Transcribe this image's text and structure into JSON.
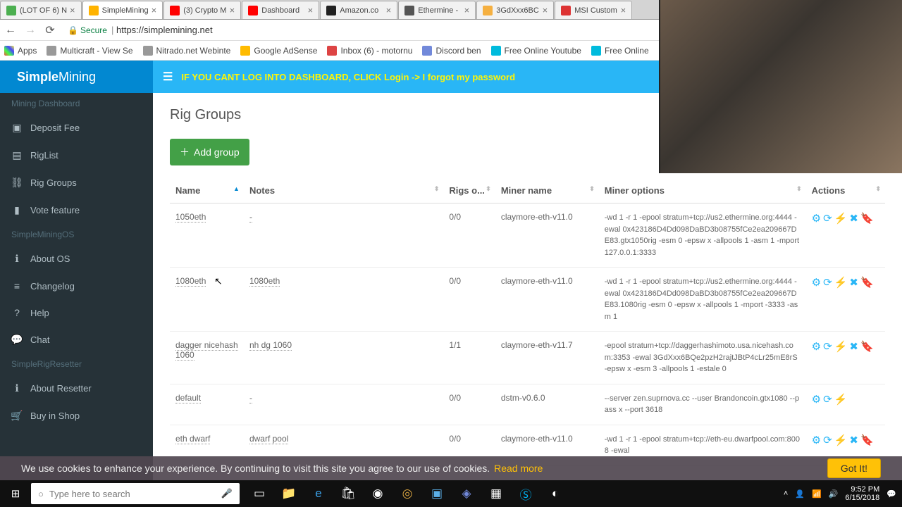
{
  "browser": {
    "tabs": [
      {
        "label": "(LOT OF 6) N",
        "favicon": "#4caf50"
      },
      {
        "label": "SimpleMining",
        "favicon": "#ffb300",
        "active": true
      },
      {
        "label": "(3) Crypto M",
        "favicon": "#f00"
      },
      {
        "label": "Dashboard",
        "favicon": "#f00"
      },
      {
        "label": "Amazon.co",
        "favicon": "#222"
      },
      {
        "label": "Ethermine -",
        "favicon": "#555"
      },
      {
        "label": "3GdXxx6BC",
        "favicon": "#f5b041"
      },
      {
        "label": "MSI Custom",
        "favicon": "#d33"
      }
    ],
    "secure_label": "Secure",
    "url": "https://simplemining.net",
    "bookmarks": [
      {
        "label": "Apps",
        "color": "#55f"
      },
      {
        "label": "Multicraft - View Se",
        "color": "#999"
      },
      {
        "label": "Nitrado.net Webinte",
        "color": "#999"
      },
      {
        "label": "Google AdSense",
        "color": "#fb0"
      },
      {
        "label": "Inbox (6) - motornu",
        "color": "#d44"
      },
      {
        "label": "Discord ben",
        "color": "#7289da"
      },
      {
        "label": "Free Online Youtube",
        "color": "#0bd"
      },
      {
        "label": "Free Online",
        "color": "#0bd"
      }
    ]
  },
  "banner": "IF YOU CANT LOG INTO DASHBOARD, CLICK Login -> I forgot my password",
  "logo": {
    "a": "Simple",
    "b": "Mining"
  },
  "sidebar": {
    "sec1": "Mining Dashboard",
    "items1": [
      {
        "icon": "▣",
        "label": "Deposit Fee"
      },
      {
        "icon": "▤",
        "label": "RigList"
      },
      {
        "icon": "⛓",
        "label": "Rig Groups"
      },
      {
        "icon": "▮",
        "label": "Vote feature"
      }
    ],
    "sec2": "SimpleMiningOS",
    "items2": [
      {
        "icon": "ℹ",
        "label": "About OS"
      },
      {
        "icon": "≡",
        "label": "Changelog"
      },
      {
        "icon": "?",
        "label": "Help"
      },
      {
        "icon": "💬",
        "label": "Chat"
      }
    ],
    "sec3": "SimpleRigResetter",
    "items3": [
      {
        "icon": "ℹ",
        "label": "About Resetter"
      },
      {
        "icon": "🛒",
        "label": "Buy in Shop"
      }
    ]
  },
  "page": {
    "title": "Rig Groups",
    "add_btn": "Add group"
  },
  "table": {
    "headers": {
      "name": "Name",
      "notes": "Notes",
      "rigs": "Rigs o...",
      "miner": "Miner name",
      "opts": "Miner options",
      "actions": "Actions"
    },
    "rows": [
      {
        "name": "1050eth",
        "notes": "-",
        "rigs": "0/0",
        "miner": "claymore-eth-v11.0",
        "opts": "-wd 1 -r 1 -epool stratum+tcp://us2.ethermine.org:4444 -ewal 0x423186D4Dd098DaBD3b08755fCe2ea209667DE83.gtx1050rig -esm 0 -epsw x -allpools 1 -asm 1 -mport 127.0.0.1:3333",
        "acts": "⚙ ⟳ ⚡ ✖ 🔖"
      },
      {
        "name": "1080eth",
        "notes": "1080eth",
        "rigs": "0/0",
        "miner": "claymore-eth-v11.0",
        "opts": "-wd 1 -r 1 -epool stratum+tcp://us2.ethermine.org:4444 -ewal 0x423186D4Dd098DaBD3b08755fCe2ea209667DE83.1080rig -esm 0 -epsw x -allpools 1 -mport -3333 -asm 1",
        "acts": "⚙ ⟳ ⚡ ✖ 🔖"
      },
      {
        "name": "dagger nicehash 1060",
        "notes": "nh dg 1060",
        "rigs": "1/1",
        "miner": "claymore-eth-v11.7",
        "opts": "-epool stratum+tcp://daggerhashimoto.usa.nicehash.com:3353 -ewal 3GdXxx6BQe2pzH2rajtJBtP4cLr25mE8rS -epsw x -esm 3 -allpools 1 -estale 0",
        "acts": "⚙ ⟳ ⚡ ✖ 🔖"
      },
      {
        "name": "default",
        "notes": "-",
        "rigs": "0/0",
        "miner": "dstm-v0.6.0",
        "opts": "--server zen.suprnova.cc --user Brandoncoin.gtx1080 --pass x --port 3618",
        "acts": "⚙ ⟳ ⚡"
      },
      {
        "name": "eth dwarf",
        "notes": "dwarf pool",
        "rigs": "0/0",
        "miner": "claymore-eth-v11.0",
        "opts": "-wd 1 -r 1 -epool stratum+tcp://eth-eu.dwarfpool.com:8008 -ewal",
        "acts": "⚙ ⟳ ⚡ ✖ 🔖"
      }
    ]
  },
  "cookie": {
    "text": "We use cookies to enhance your experience. By continuing to visit this site you agree to our use of cookies.",
    "link": "Read more",
    "btn": "Got It!"
  },
  "taskbar": {
    "search_ph": "Type here to search",
    "time": "9:52 PM",
    "date": "6/15/2018"
  }
}
